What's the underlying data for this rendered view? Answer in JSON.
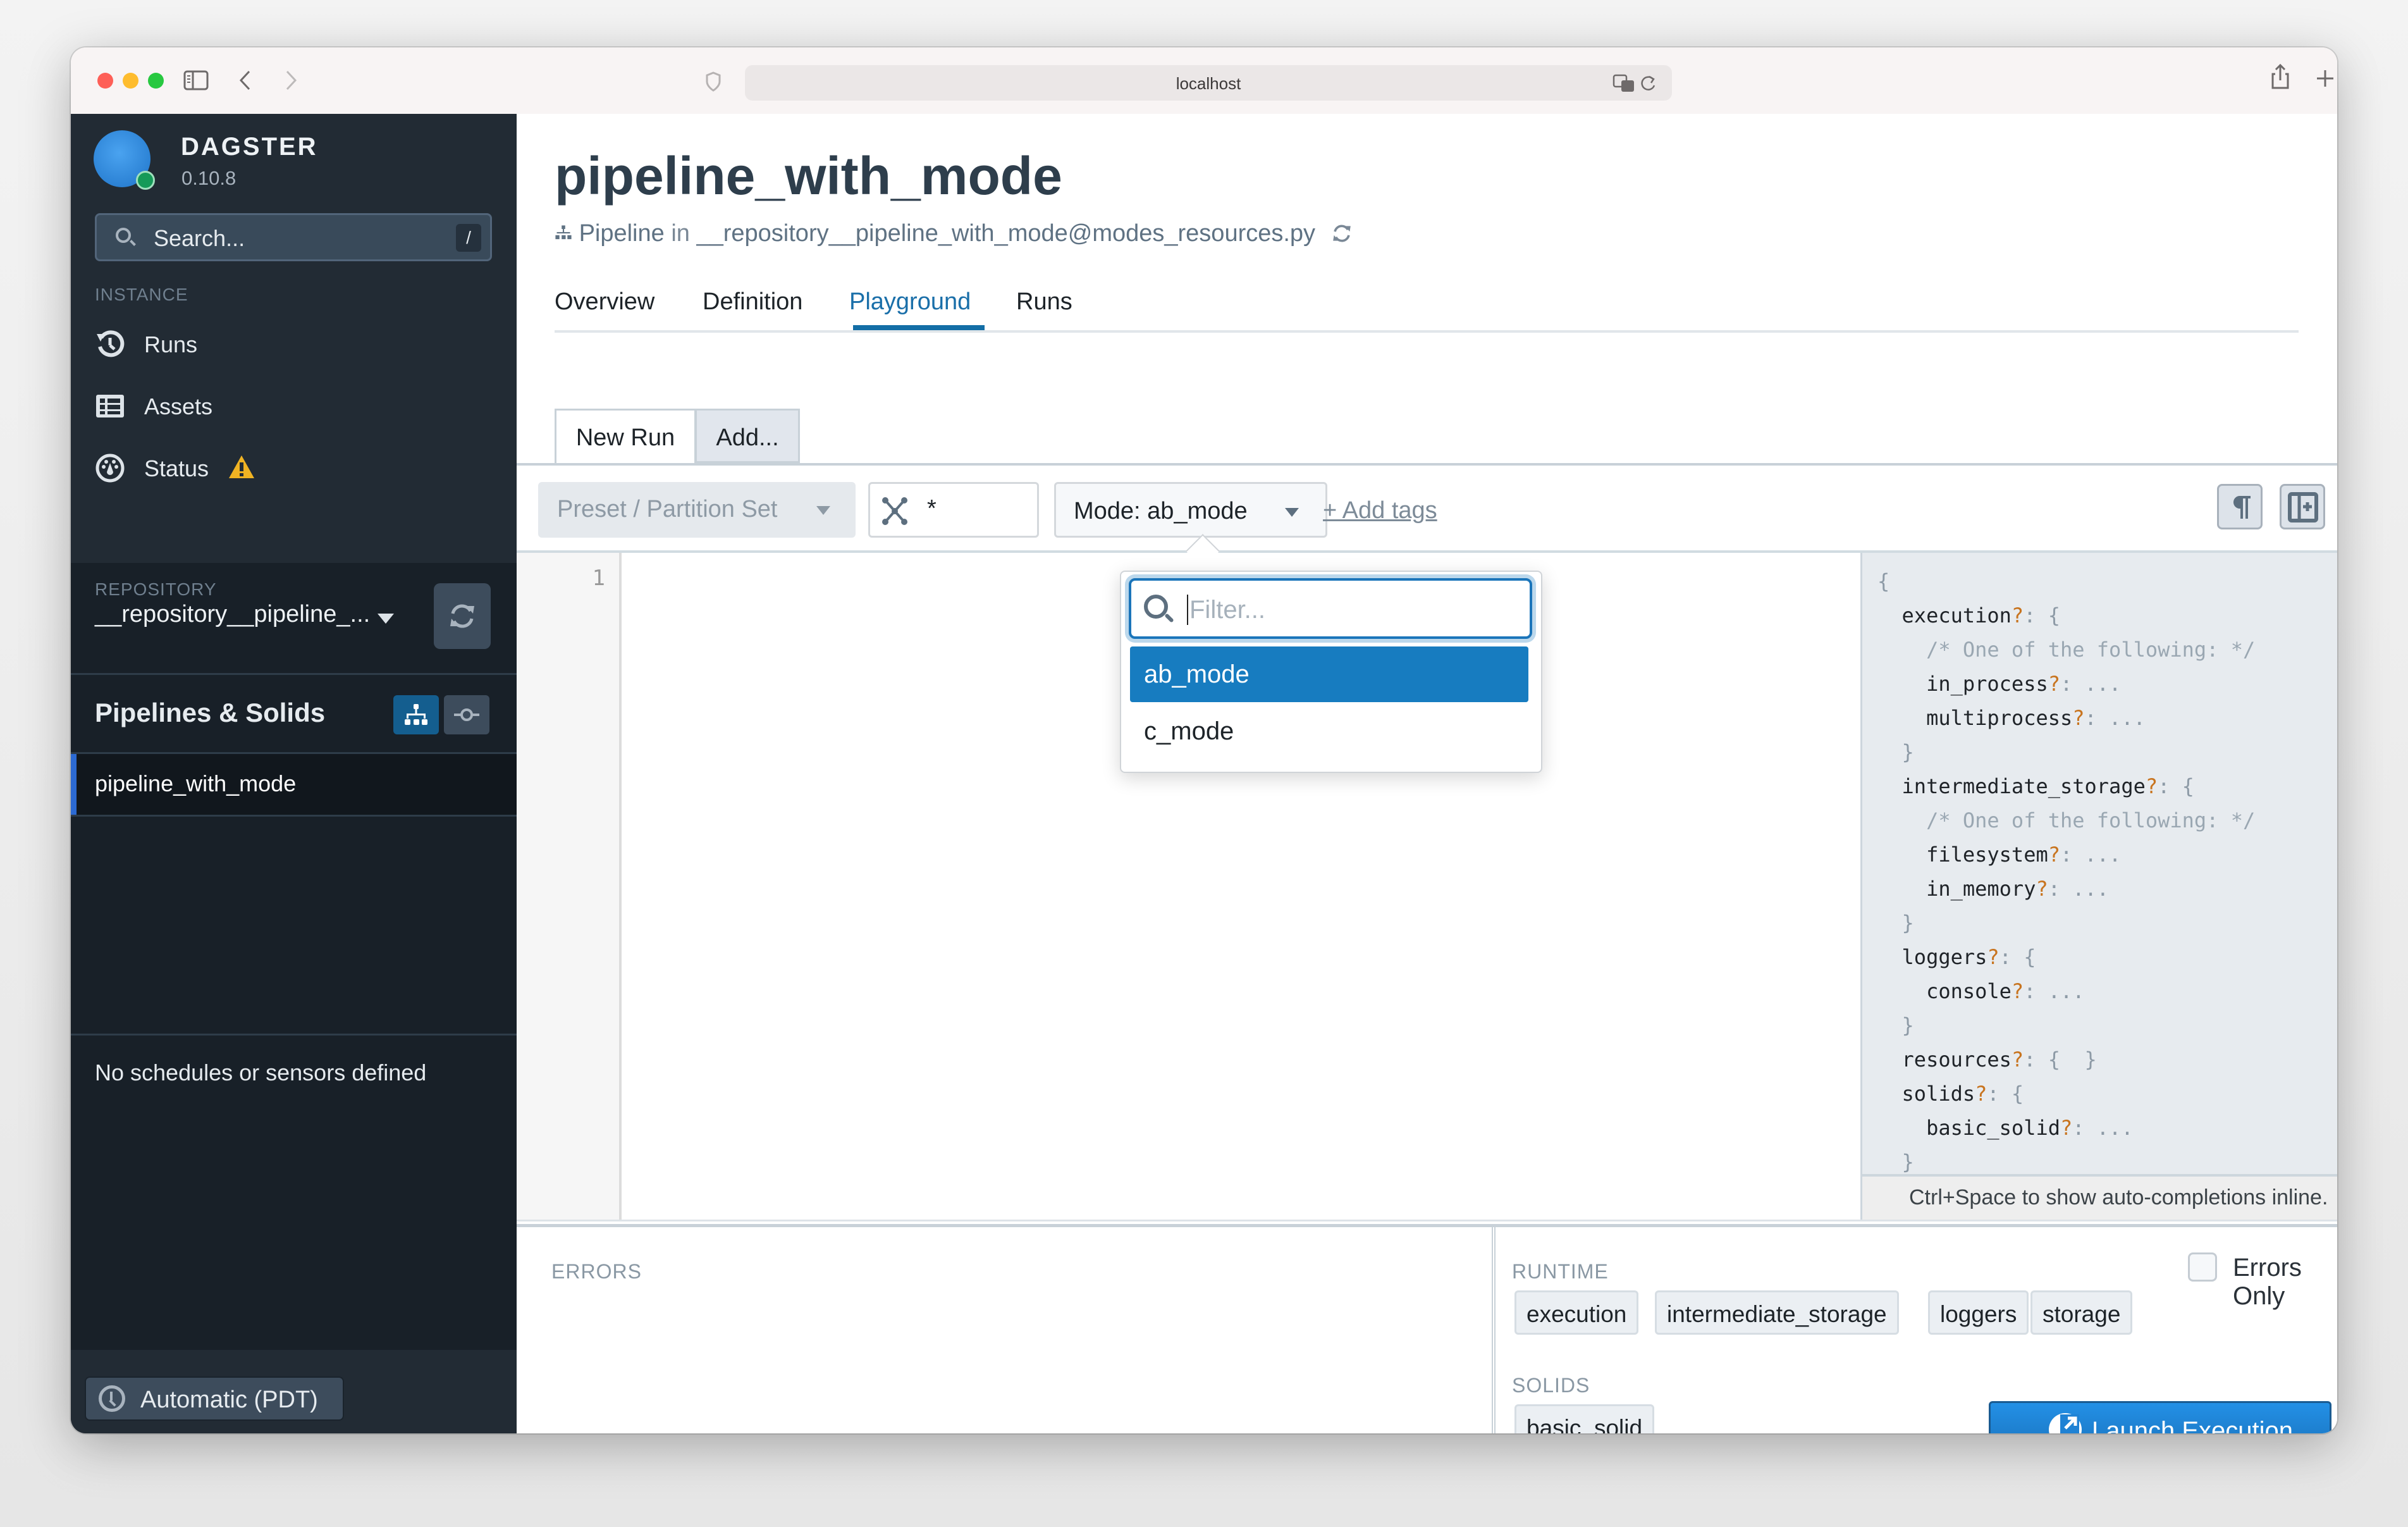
{
  "browser": {
    "url": "localhost",
    "icons": [
      "sidebar-toggle-icon",
      "back-icon",
      "forward-icon",
      "shield-icon",
      "translate-icon",
      "reload-icon",
      "share-icon",
      "new-tab-icon",
      "tabs-overview-icon"
    ]
  },
  "sidebar": {
    "brand": "DAGSTER",
    "version": "0.10.8",
    "search": {
      "placeholder": "Search...",
      "shortcut": "/"
    },
    "instance_label": "INSTANCE",
    "instance_items": [
      {
        "label": "Runs",
        "icon": "history-icon"
      },
      {
        "label": "Assets",
        "icon": "table-icon"
      },
      {
        "label": "Status",
        "icon": "dashboard-icon",
        "badge": "warning-icon"
      }
    ],
    "repository_label": "REPOSITORY",
    "repository_name": "__repository__pipeline_...",
    "pipelines_title": "Pipelines & Solids",
    "pipelines": [
      {
        "label": "pipeline_with_mode",
        "selected": true
      }
    ],
    "schedules_empty": "No schedules or sensors defined",
    "timezone": "Automatic (PDT)"
  },
  "header": {
    "title": "pipeline_with_mode",
    "subtitle_kind": "Pipeline",
    "subtitle_in": "in",
    "subtitle_location": "__repository__pipeline_with_mode@modes_resources.py",
    "tabs": [
      {
        "label": "Overview",
        "active": false
      },
      {
        "label": "Definition",
        "active": false
      },
      {
        "label": "Playground",
        "active": true
      },
      {
        "label": "Runs",
        "active": false
      }
    ]
  },
  "playground": {
    "run_tabs": [
      {
        "label": "New Run",
        "active": true
      },
      {
        "label": "Add...",
        "active": false
      }
    ],
    "preset_placeholder": "Preset / Partition Set",
    "solid_selection": "*",
    "mode_label": "Mode: ab_mode",
    "add_tags": "+ Add tags",
    "mode_dropdown": {
      "filter_placeholder": "Filter...",
      "options": [
        {
          "label": "ab_mode",
          "selected": true
        },
        {
          "label": "c_mode",
          "selected": false
        }
      ]
    },
    "editor": {
      "line_numbers": [
        "1"
      ],
      "content": ""
    },
    "config_hint_lines": [
      {
        "indent": 0,
        "key": "",
        "text": "{"
      },
      {
        "indent": 1,
        "key": "execution",
        "text": "{"
      },
      {
        "indent": 2,
        "comment": "/* One of the following: */"
      },
      {
        "indent": 2,
        "key": "in_process",
        "text": "..."
      },
      {
        "indent": 2,
        "key": "multiprocess",
        "text": "..."
      },
      {
        "indent": 1,
        "key": "",
        "text": "}"
      },
      {
        "indent": 1,
        "key": "intermediate_storage",
        "text": "{"
      },
      {
        "indent": 2,
        "comment": "/* One of the following: */"
      },
      {
        "indent": 2,
        "key": "filesystem",
        "text": "..."
      },
      {
        "indent": 2,
        "key": "in_memory",
        "text": "..."
      },
      {
        "indent": 1,
        "key": "",
        "text": "}"
      },
      {
        "indent": 1,
        "key": "loggers",
        "text": "{"
      },
      {
        "indent": 2,
        "key": "console",
        "text": "..."
      },
      {
        "indent": 1,
        "key": "",
        "text": "}"
      },
      {
        "indent": 1,
        "key": "resources",
        "text": "{  }"
      },
      {
        "indent": 1,
        "key": "solids",
        "text": "{"
      },
      {
        "indent": 2,
        "key": "basic_solid",
        "text": "..."
      },
      {
        "indent": 1,
        "key": "",
        "text": "}"
      }
    ],
    "hint_footer": "Ctrl+Space to show auto-completions inline."
  },
  "bottom": {
    "errors_label": "ERRORS",
    "runtime_label": "RUNTIME",
    "runtime_chips": [
      "execution",
      "intermediate_storage",
      "loggers",
      "storage"
    ],
    "solids_label": "SOLIDS",
    "solid_chips": [
      "basic_solid"
    ],
    "errors_only_label": "Errors Only",
    "errors_only_checked": false,
    "launch_label": "Launch Execution"
  },
  "colors": {
    "accent": "#136ea6",
    "sidebar_bg": "#222b34",
    "selected_option": "#177cc0",
    "launch_button": "#2390e6",
    "warning": "#f0b323",
    "status_ok": "#159a58"
  }
}
